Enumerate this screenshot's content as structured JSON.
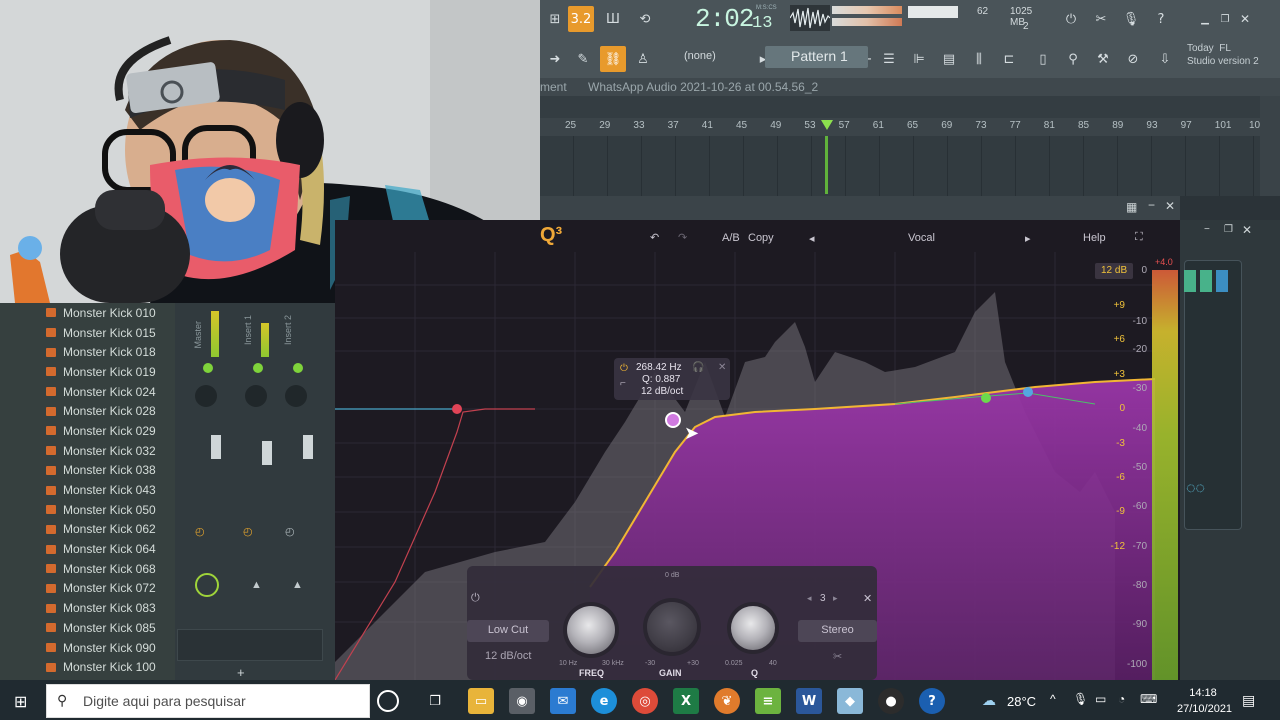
{
  "toolbar": {
    "time": "2:02",
    "time_frac": "13",
    "time_label": "M:S:CS",
    "tempo_display": "3.2",
    "cpu_value": "62",
    "ram_value": "1025 MB",
    "polyphony": "2",
    "none_label": "(none)",
    "pattern_label": "Pattern 1",
    "today_line1": "Today",
    "today_fl": "FL",
    "today_line2": "Studio version 2"
  },
  "playlist": {
    "title_prefix": "ment",
    "title": "WhatsApp Audio 2021-10-26 at 00.54.56_2",
    "ruler": [
      "25",
      "29",
      "33",
      "37",
      "41",
      "45",
      "49",
      "53",
      "57",
      "61",
      "65",
      "69",
      "73",
      "77",
      "81",
      "85",
      "89",
      "93",
      "97",
      "101",
      "10"
    ]
  },
  "browser": {
    "items": [
      "Monster Kick 010",
      "Monster Kick 015",
      "Monster Kick 018",
      "Monster Kick 019",
      "Monster Kick 024",
      "Monster Kick 028",
      "Monster Kick 029",
      "Monster Kick 032",
      "Monster Kick 038",
      "Monster Kick 043",
      "Monster Kick 050",
      "Monster Kick 062",
      "Monster Kick 064",
      "Monster Kick 068",
      "Monster Kick 072",
      "Monster Kick 083",
      "Monster Kick 085",
      "Monster Kick 090",
      "Monster Kick 100",
      "Monster Kick 1"
    ]
  },
  "mixer": {
    "strips": [
      "Master",
      "Insert 1",
      "Insert 2"
    ]
  },
  "eq": {
    "logo": "Q³",
    "ab_label": "A/B",
    "copy_label": "Copy",
    "preset_name": "Vocal",
    "help_label": "Help",
    "gain_scale": "12 dB",
    "db_labels": [
      "+9",
      "+6",
      "+3",
      "0",
      "-3",
      "-6",
      "-9",
      "-12"
    ],
    "db_grey_labels": [
      "0",
      "-10",
      "-20",
      "-30",
      "-40",
      "-50",
      "-60",
      "-70",
      "-80",
      "-90",
      "-100"
    ],
    "meter_peak": "+4.0",
    "tooltip": {
      "freq": "268.42 Hz",
      "q": "Q: 0.887",
      "slope": "12 dB/oct"
    },
    "panel": {
      "low_cut_label": "Low Cut",
      "slope_label": "12 dB/oct",
      "band_number": "3",
      "freq_label": "FREQ",
      "freq_min": "10 Hz",
      "freq_max": "30 kHz",
      "gain_label": "GAIN",
      "gain_center": "0 dB",
      "gain_min": "-30",
      "gain_max": "+30",
      "q_label": "Q",
      "q_min": "0.025",
      "q_max": "40",
      "stereo_label": "Stereo"
    }
  },
  "taskbar": {
    "search_placeholder": "Digite aqui para pesquisar",
    "weather": "28°C",
    "time": "14:18",
    "date": "27/10/2021"
  },
  "colors": {
    "accent_orange": "#e89a2c",
    "eq_purple": "#8e2f9a",
    "eq_curve": "#f1b634",
    "playhead": "#6cd13a"
  }
}
